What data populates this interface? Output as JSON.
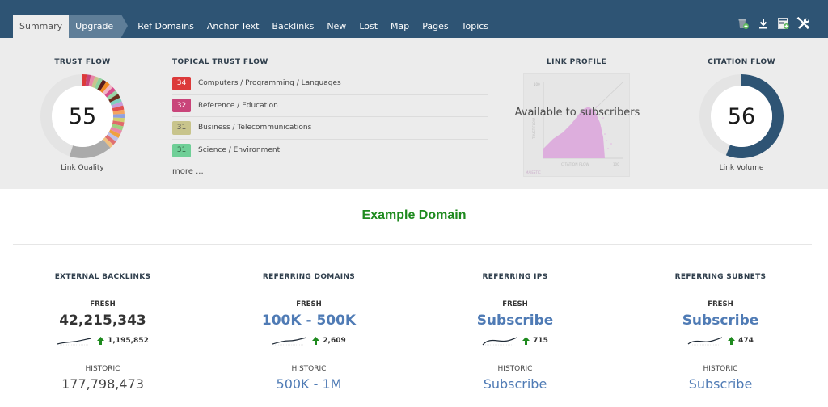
{
  "tabs": [
    {
      "label": "Summary",
      "state": "active"
    },
    {
      "label": "Upgrade",
      "state": "upgrade"
    },
    {
      "label": "Ref Domains"
    },
    {
      "label": "Anchor Text"
    },
    {
      "label": "Backlinks"
    },
    {
      "label": "New"
    },
    {
      "label": "Lost"
    },
    {
      "label": "Map"
    },
    {
      "label": "Pages"
    },
    {
      "label": "Topics"
    }
  ],
  "tools": [
    "add-to-bucket-icon",
    "download-icon",
    "add-report-icon",
    "tools-icon"
  ],
  "trust_flow": {
    "title": "TRUST FLOW",
    "value": "55",
    "caption": "Link Quality"
  },
  "topical_trust_flow": {
    "title": "TOPICAL TRUST FLOW",
    "items": [
      {
        "score": "34",
        "label": "Computers / Programming / Languages",
        "color": "#dc3a3a"
      },
      {
        "score": "32",
        "label": "Reference / Education",
        "color": "#c9457a"
      },
      {
        "score": "31",
        "label": "Business / Telecommunications",
        "color": "#c8c48c"
      },
      {
        "score": "31",
        "label": "Science / Environment",
        "color": "#6fcf97"
      }
    ],
    "more": "more ..."
  },
  "link_profile": {
    "title": "LINK PROFILE",
    "overlay": "Available to subscribers",
    "x_axis": "CITATION FLOW",
    "y_axis": "TRUST FLOW",
    "axis_max": "100",
    "brand": "MAJESTIC"
  },
  "citation_flow": {
    "title": "CITATION FLOW",
    "value": "56",
    "caption": "Link Volume",
    "color": "#2e5474"
  },
  "domain": {
    "title": "Example Domain",
    "color": "#1e8a1e"
  },
  "stats": [
    {
      "title": "EXTERNAL BACKLINKS",
      "fresh_label": "FRESH",
      "fresh": "42,215,343",
      "fresh_link": false,
      "trend": "1,195,852",
      "historic_label": "HISTORIC",
      "historic": "177,798,473",
      "historic_link": false
    },
    {
      "title": "REFERRING DOMAINS",
      "fresh_label": "FRESH",
      "fresh": "100K - 500K",
      "fresh_link": true,
      "trend": "2,609",
      "historic_label": "HISTORIC",
      "historic": "500K - 1M",
      "historic_link": true
    },
    {
      "title": "REFERRING IPS",
      "fresh_label": "FRESH",
      "fresh": "Subscribe",
      "fresh_link": true,
      "trend": "715",
      "historic_label": "HISTORIC",
      "historic": "Subscribe",
      "historic_link": true
    },
    {
      "title": "REFERRING SUBNETS",
      "fresh_label": "FRESH",
      "fresh": "Subscribe",
      "fresh_link": true,
      "trend": "474",
      "historic_label": "HISTORIC",
      "historic": "Subscribe",
      "historic_link": true
    }
  ]
}
